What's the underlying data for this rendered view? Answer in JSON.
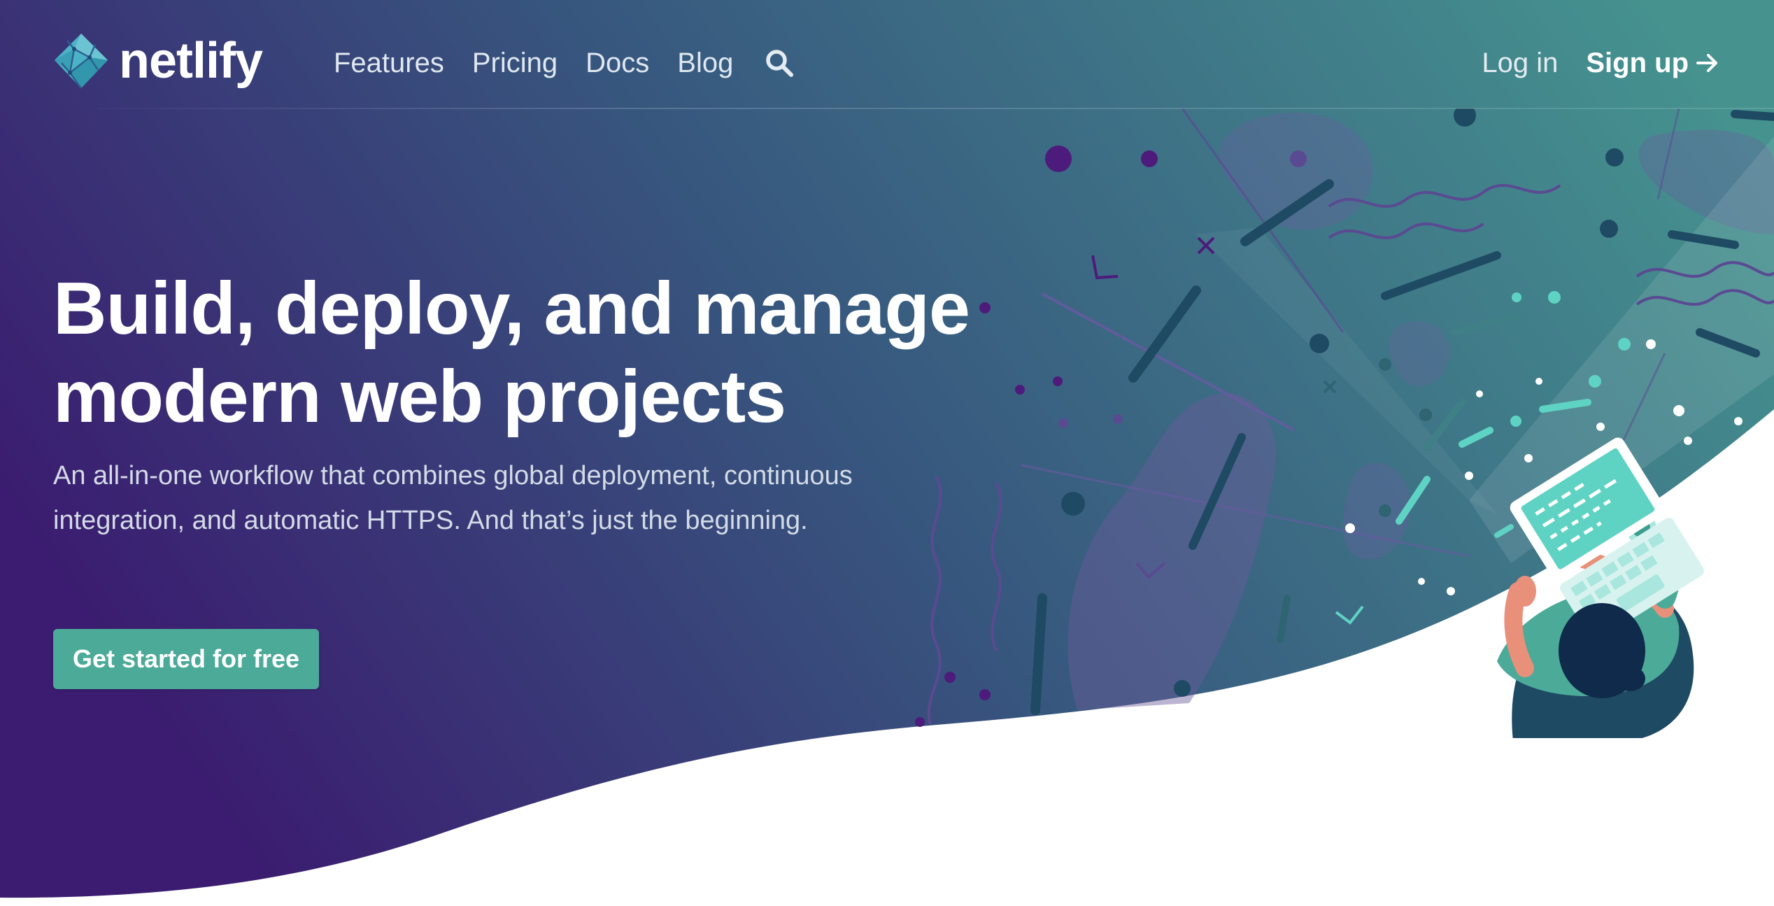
{
  "brand": {
    "name": "netlify",
    "logo_icon": "netlify-logo-icon"
  },
  "nav": {
    "items": [
      {
        "label": "Features"
      },
      {
        "label": "Pricing"
      },
      {
        "label": "Docs"
      },
      {
        "label": "Blog"
      }
    ],
    "search_icon": "search-icon"
  },
  "auth": {
    "login_label": "Log in",
    "signup_label": "Sign up",
    "signup_icon": "arrow-right-icon"
  },
  "hero": {
    "headline_line_1": "Build, deploy, and manage",
    "headline_line_2": "modern web projects",
    "subtext": "An all-in-one workflow that combines global deployment, continuous integration, and automatic HTTPS. And that’s just the beginning.",
    "cta_label": "Get started for free",
    "illustration": "developer-at-laptop-illustration"
  },
  "colors": {
    "gradient_start": "#3b1c70",
    "gradient_mid": "#37567e",
    "gradient_end": "#45928f",
    "cta": "#4caa99",
    "accent_teal": "#5fd3c3",
    "bottom_background": "#ffffff"
  }
}
